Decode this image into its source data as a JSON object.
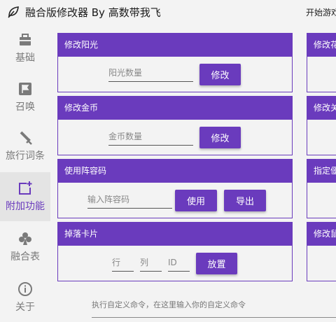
{
  "window": {
    "title": "融合版修改器 By 高数带我飞",
    "top_link": "开始游戏",
    "icon": "leaf-icon"
  },
  "sidebar": {
    "items": [
      {
        "label": "基础",
        "icon": "bag-icon"
      },
      {
        "label": "召唤",
        "icon": "flag-icon"
      },
      {
        "label": "旅行词条",
        "icon": "sword-icon"
      },
      {
        "label": "附加功能",
        "icon": "add-window-icon",
        "active": true
      },
      {
        "label": "融合表",
        "icon": "club-icon"
      },
      {
        "label": "关于",
        "icon": "info-icon"
      }
    ]
  },
  "cards": {
    "sun": {
      "title": "修改阳光",
      "placeholder": "阳光数量",
      "button": "修改"
    },
    "coin": {
      "title": "修改金币",
      "placeholder": "金币数量",
      "button": "修改"
    },
    "lineup": {
      "title": "使用阵容码",
      "placeholder": "输入阵容码",
      "button_use": "使用",
      "button_export": "导出"
    },
    "card_drop": {
      "title": "掉落卡片",
      "row_placeholder": "行",
      "col_placeholder": "列",
      "id_placeholder": "ID",
      "button": "放置"
    }
  },
  "right_cards": [
    "修改花",
    "修改关",
    "指定僵",
    "修改鼠"
  ],
  "command": {
    "placeholder": "执行自定义命令，在这里输入你的自定义命令"
  },
  "colors": {
    "accent": "#6a3bbd",
    "background": "#f3f3f3"
  }
}
